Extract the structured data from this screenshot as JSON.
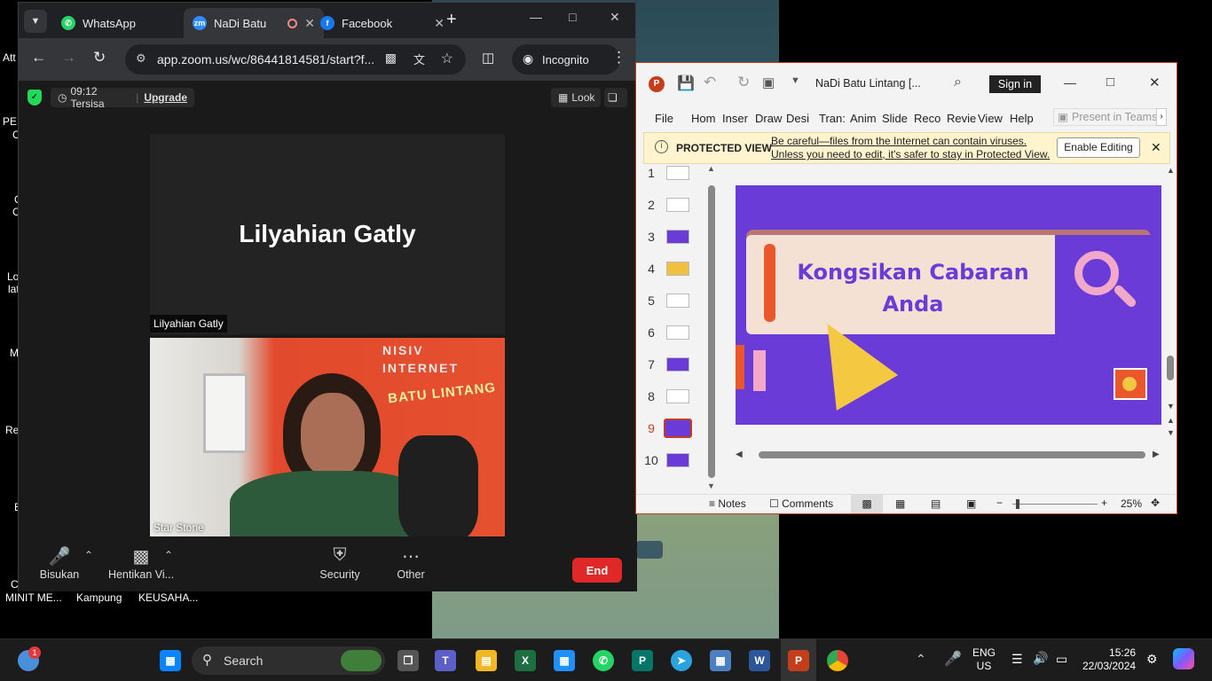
{
  "desktop": {
    "left_labels": [
      "Att",
      "PED",
      "C",
      "C",
      "C",
      "Lo",
      "lat",
      "M",
      "Re",
      "E",
      "C"
    ],
    "bottom_labels": [
      "MINIT ME...",
      "Kampung",
      "KEUSAHA..."
    ]
  },
  "chrome": {
    "tabs": [
      {
        "label": "WhatsApp",
        "icon": "whatsapp-icon"
      },
      {
        "label": "NaDi Batu",
        "icon": "zoom-icon"
      },
      {
        "label": "Facebook",
        "icon": "facebook-icon"
      }
    ],
    "address": "app.zoom.us/wc/86441814581/start?f...",
    "incognito_label": "Incognito"
  },
  "zoom": {
    "timer": "09:12 Tersisa",
    "upgrade_label": "Upgrade",
    "look_label": "Look",
    "participant1_name": "Lilyahian Gatly",
    "participant1_tag": "Lilyahian Gatly",
    "participant2_tag": "Star Stone",
    "video_sign_line1": "NISIV",
    "video_sign_line2": "INTERNET",
    "video_sign_line3": "BATU LINTANG",
    "toolbar": {
      "mic_label": "Bisukan",
      "video_label": "Hentikan Vi...",
      "security_label": "Security",
      "other_label": "Other",
      "end_label": "End"
    }
  },
  "powerpoint": {
    "title": "NaDi Batu Lintang [...",
    "sign_in_label": "Sign in",
    "menu": [
      "File",
      "Hom",
      "Inser",
      "Draw",
      "Desi",
      "Tran:",
      "Anim",
      "Slide",
      "Reco",
      "Revie",
      "View",
      "Help"
    ],
    "present_teams_label": "Present in Teams",
    "protected_view": {
      "label": "PROTECTED VIEW",
      "line1": "Be careful—files from the Internet can contain viruses.",
      "line2": "Unless you need to edit, it's safer to stay in Protected View.",
      "button": "Enable Editing"
    },
    "slide_numbers": [
      "1",
      "2",
      "3",
      "4",
      "5",
      "6",
      "7",
      "8",
      "9",
      "10"
    ],
    "selected_slide": "9",
    "slide_text_line1": "Kongsikan Cabaran",
    "slide_text_line2": "Anda",
    "status": {
      "notes_label": "Notes",
      "comments_label": "Comments",
      "zoom_level": "25%"
    }
  },
  "taskbar": {
    "search_label": "Search",
    "notification_count": "1",
    "lang_line1": "ENG",
    "lang_line2": "US",
    "time": "15:26",
    "date": "22/03/2024"
  },
  "colors": {
    "zoom_end": "#e02828",
    "ppt_accent": "#c43e1c",
    "slide_bg": "#6a3bd6",
    "slide_text": "#6a3bd6"
  }
}
